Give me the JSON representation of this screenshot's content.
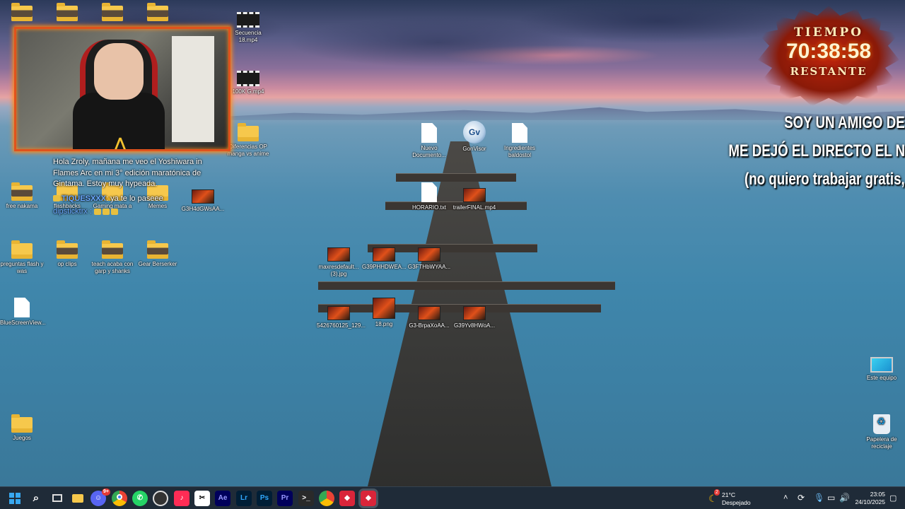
{
  "desktop": {
    "icons": [
      {
        "label": "",
        "kind": "folder"
      },
      {
        "label": "",
        "kind": "folder"
      },
      {
        "label": "",
        "kind": "folder"
      },
      {
        "label": "",
        "kind": "folder"
      },
      {
        "label": "Secuencia 18.mp4",
        "kind": "video"
      },
      {
        "label": "100K G.mp4",
        "kind": "video"
      },
      {
        "label": "Diferencias OP manga vs anime",
        "kind": "folder"
      },
      {
        "label": "Nuevo Documento...",
        "kind": "doc"
      },
      {
        "label": "GonVisor",
        "kind": "app"
      },
      {
        "label": "Ingredientes baldostol",
        "kind": "doc"
      },
      {
        "label": "free nakama",
        "kind": "folder"
      },
      {
        "label": "flashbacks",
        "kind": "folder"
      },
      {
        "label": "Gaming mata a",
        "kind": "folder"
      },
      {
        "label": "Memes",
        "kind": "folder"
      },
      {
        "label": "G3H4dGWsAA...",
        "kind": "image"
      },
      {
        "label": "HORARIO.txt",
        "kind": "doc"
      },
      {
        "label": "trailerFINAL.mp4",
        "kind": "video"
      },
      {
        "label": "preguntas flash y was",
        "kind": "folder"
      },
      {
        "label": "op clips",
        "kind": "folder"
      },
      {
        "label": "teach acaba con garp y shanks",
        "kind": "folder"
      },
      {
        "label": "Gear Berserker",
        "kind": "folder"
      },
      {
        "label": "maxresdefault... (3).jpg",
        "kind": "image"
      },
      {
        "label": "G39PHHDWEA...",
        "kind": "image"
      },
      {
        "label": "G3FTHbWYAA...",
        "kind": "image"
      },
      {
        "label": "BlueScreenView...",
        "kind": "doc"
      },
      {
        "label": "5426760125_129...",
        "kind": "image"
      },
      {
        "label": "18.png",
        "kind": "image"
      },
      {
        "label": "G3-BrpaXoAA...",
        "kind": "image"
      },
      {
        "label": "G39Yv8HWoA...",
        "kind": "image"
      },
      {
        "label": "Este equipo",
        "kind": "computer"
      },
      {
        "label": "Juegos",
        "kind": "folder"
      },
      {
        "label": "Papelera de reciclaje",
        "kind": "bin"
      }
    ]
  },
  "chat": {
    "message1": "Hola Zroly, mañana me veo el Yoshiwara in Flames Arc en mi 3° edición maratónica de Gintama. Estoy muy hypeada.",
    "user2": "TIQUESXXX",
    "message2": ": ya te lo paseee",
    "user3": "dipsticktrx :"
  },
  "timer": {
    "title": "TIEMPO",
    "value": "70:38:58",
    "subtitle": "RESTANTE"
  },
  "overlay": {
    "line1": "SOY UN AMIGO DE",
    "line2": "ME DEJÓ EL DIRECTO EL N",
    "line3": "(no quiero trabajar gratis,"
  },
  "taskbar": {
    "apps": [
      {
        "name": "search-icon",
        "label": ""
      },
      {
        "name": "task-view-icon",
        "label": ""
      },
      {
        "name": "file-explorer-icon",
        "label": ""
      },
      {
        "name": "discord-icon",
        "label": ""
      },
      {
        "name": "chrome-icon",
        "label": ""
      },
      {
        "name": "whatsapp-icon",
        "label": ""
      },
      {
        "name": "obs-icon",
        "label": ""
      },
      {
        "name": "tiktok-icon",
        "label": ""
      },
      {
        "name": "capcut-icon",
        "label": ""
      },
      {
        "name": "after-effects-icon",
        "label": "Ae"
      },
      {
        "name": "lightroom-icon",
        "label": "Lr"
      },
      {
        "name": "photoshop-icon",
        "label": "Ps"
      },
      {
        "name": "premiere-icon",
        "label": "Pr"
      },
      {
        "name": "terminal-icon",
        "label": ""
      },
      {
        "name": "chrome-alt-icon",
        "label": ""
      },
      {
        "name": "app-red-icon",
        "label": ""
      },
      {
        "name": "app-red-active-icon",
        "label": ""
      }
    ],
    "discord_badge": "9+",
    "weather_badge": "2",
    "weather_temp": "21°C",
    "weather_desc": "Despejado",
    "time": "23:05",
    "date": "24/10/2025"
  }
}
